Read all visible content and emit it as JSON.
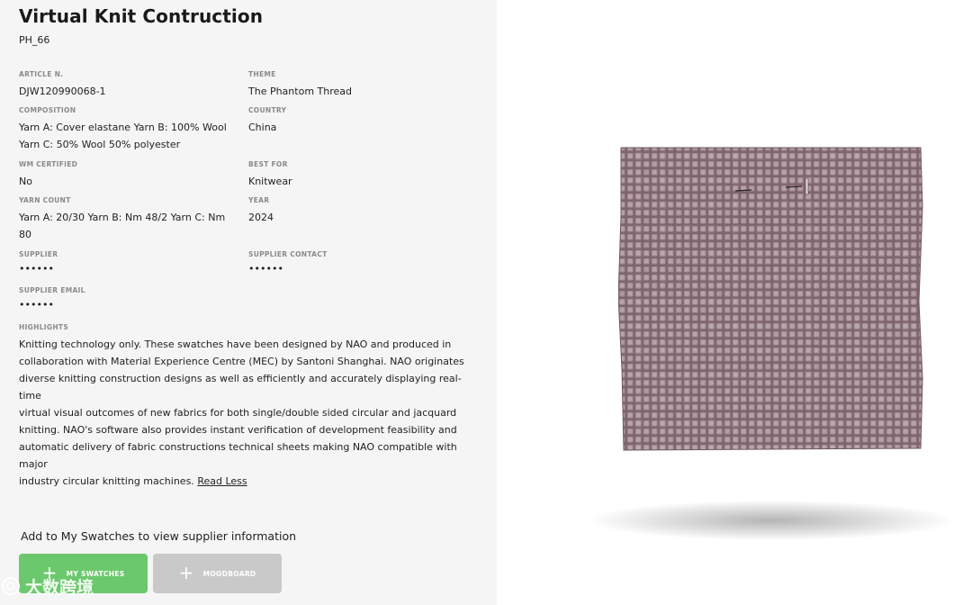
{
  "product": {
    "title": "Virtual Knit Contruction",
    "code": "PH_66"
  },
  "fields": {
    "article": {
      "label": "ARTICLE N.",
      "value": "DJW120990068-1"
    },
    "theme": {
      "label": "THEME",
      "value": "The Phantom Thread"
    },
    "composition": {
      "label": "COMPOSITION",
      "value_line1": "Yarn A: Cover elastane Yarn B: 100% Wool",
      "value_line2": "Yarn C: 50% Wool 50% polyester"
    },
    "country": {
      "label": "COUNTRY",
      "value": "China"
    },
    "wm_certified": {
      "label": "WM CERTIFIED",
      "value": "No"
    },
    "best_for": {
      "label": "BEST FOR",
      "value": "Knitwear"
    },
    "yarn_count": {
      "label": "YARN COUNT",
      "value_line1": "Yarn A: 20/30 Yarn B: Nm 48/2 Yarn C: Nm",
      "value_line2": "80"
    },
    "year": {
      "label": "YEAR",
      "value": "2024"
    },
    "supplier": {
      "label": "SUPPLIER",
      "value": "••••••"
    },
    "supplier_contact": {
      "label": "SUPPLIER CONTACT",
      "value": "••••••"
    },
    "supplier_email": {
      "label": "SUPPLIER EMAIL",
      "value": "••••••"
    }
  },
  "highlights": {
    "label": "HIGHLIGHTS",
    "lines": [
      "Knitting technology only. These swatches have been designed by NAO and produced in",
      "collaboration with Material Experience Centre (MEC) by Santoni Shanghai. NAO originates",
      "diverse knitting construction designs as well as efficiently and accurately displaying real-time",
      "virtual visual outcomes of new fabrics for both single/double sided circular and jacquard",
      "knitting. NAO's software also provides instant verification of development feasibility and",
      "automatic delivery of fabric constructions technical sheets making NAO compatible with major",
      "industry circular knitting machines."
    ],
    "read_less": "Read Less"
  },
  "actions": {
    "note": "Add to My Swatches to view supplier information",
    "my_swatches": "MY SWATCHES",
    "moodboard": "MOODBOARD",
    "plus_icon": "+"
  },
  "watermark": {
    "text": "大数跨境"
  },
  "colors": {
    "swatch_button": "#6cc86c",
    "moodboard_button": "#c9c9c9",
    "fabric_base": "#8a7078",
    "fabric_highlight": "#b8a6ac"
  }
}
